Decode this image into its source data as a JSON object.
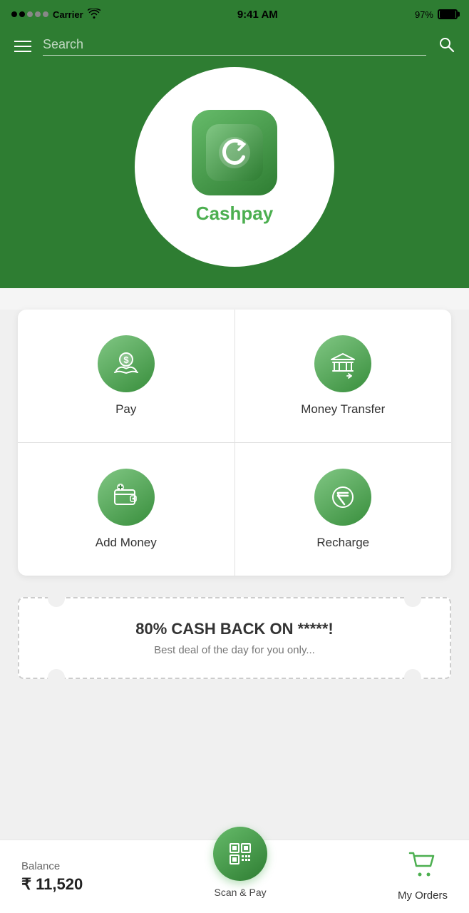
{
  "statusBar": {
    "carrier": "Carrier",
    "time": "9:41 AM",
    "battery": "97%"
  },
  "searchBar": {
    "placeholder": "Search"
  },
  "hero": {
    "logoText": "Cashpay"
  },
  "grid": {
    "items": [
      {
        "id": "pay",
        "label": "Pay",
        "icon": "pay"
      },
      {
        "id": "money-transfer",
        "label": "Money Transfer",
        "icon": "transfer"
      },
      {
        "id": "add-money",
        "label": "Add Money",
        "icon": "wallet"
      },
      {
        "id": "recharge",
        "label": "Recharge",
        "icon": "rupee"
      }
    ]
  },
  "promo": {
    "title": "80% CASH BACK ON *****!",
    "subtitle": "Best deal of the day for you only..."
  },
  "bottomBar": {
    "balanceLabel": "Balance",
    "balanceAmount": "₹ 11,520",
    "scanLabel": "Scan & Pay",
    "ordersLabel": "My Orders"
  }
}
